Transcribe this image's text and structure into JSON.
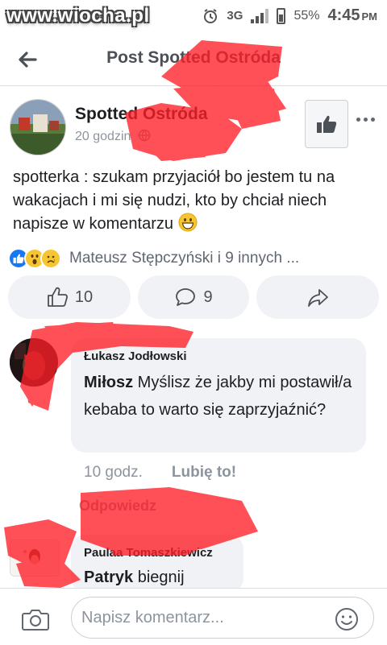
{
  "status_bar": {
    "watermark": "www.wiocha.pl",
    "network": "3G",
    "battery": "55%",
    "time": "4:45",
    "ampm": "PM"
  },
  "header": {
    "title": "Post Spotted Ostróda"
  },
  "post": {
    "author": "Spotted Ostróda",
    "time": "20 godzin",
    "text": "spotterka : szukam przyjaciół bo jestem tu na wakacjach i mi się nudzi, kto by chciał niech napisze w komentarzu",
    "reactions_summary": "Mateusz Stępczyński i 9 innych ...",
    "like_count": "10",
    "comment_count": "9"
  },
  "comments": [
    {
      "author": "Łukasz Jodłowski",
      "mention": "Miłosz",
      "text": " Myślisz że jakby mi postawił/a kebaba to warto się zaprzyjaźnić?",
      "time": "10 godz.",
      "like_label": "Lubię to!",
      "reply_label": "Odpowiedz"
    },
    {
      "author": "Paulaa Tomaszkiewicz",
      "mention": "Patryk",
      "text": " biegnij"
    }
  ],
  "composer": {
    "placeholder": "Napisz komentarz..."
  },
  "colors": {
    "brand_grey": "#4b4f56",
    "bubble": "#f0f2f5",
    "meta": "#8d949e",
    "redaction": "#ff1e28"
  }
}
